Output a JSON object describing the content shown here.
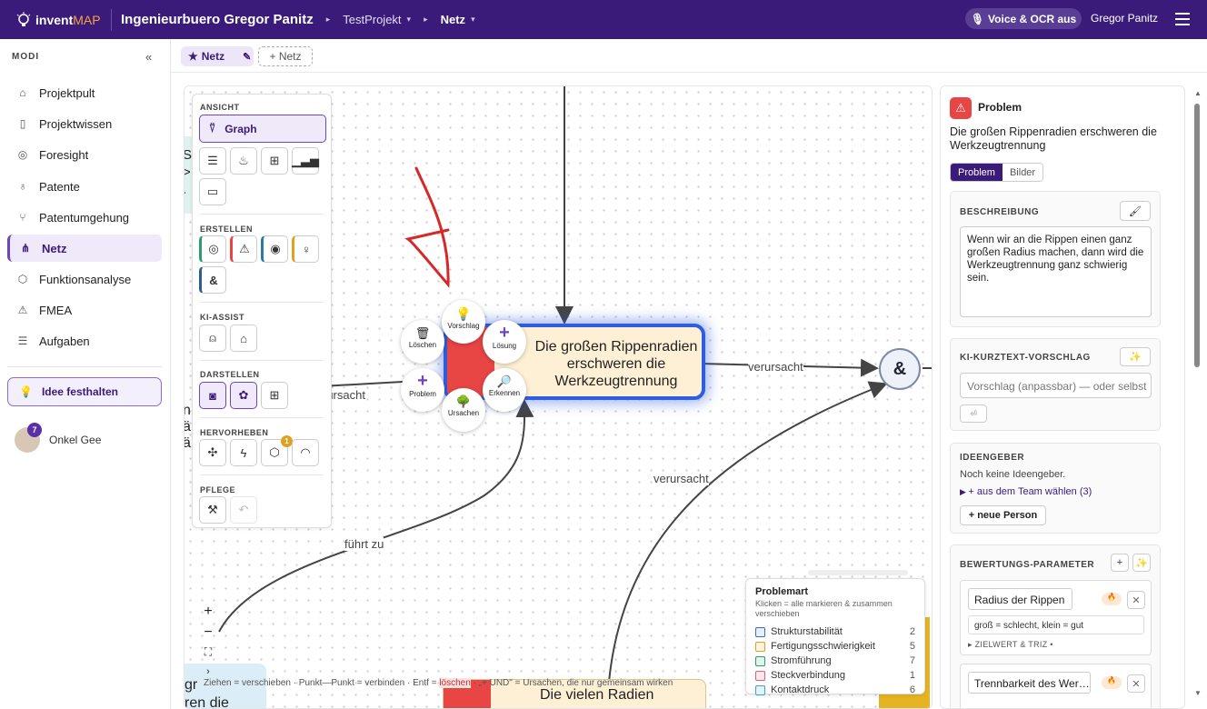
{
  "topbar": {
    "logo_main": "invent",
    "logo_accent": "MAP",
    "breadcrumb": [
      "Ingenieurbuero Gregor Panitz",
      "TestProjekt",
      "Netz"
    ],
    "voice_label": "Voice & OCR aus",
    "user_name": "Gregor Panitz"
  },
  "sidebar": {
    "heading": "MODI",
    "collapse": "«",
    "items": [
      {
        "label": "Projektpult",
        "icon": "home-icon"
      },
      {
        "label": "Projektwissen",
        "icon": "book-icon"
      },
      {
        "label": "Foresight",
        "icon": "compass-icon"
      },
      {
        "label": "Patente",
        "icon": "award-icon"
      },
      {
        "label": "Patentumgehung",
        "icon": "branch-icon"
      },
      {
        "label": "Netz",
        "icon": "network-icon",
        "active": true
      },
      {
        "label": "Funktionsanalyse",
        "icon": "cube-icon"
      },
      {
        "label": "FMEA",
        "icon": "warning-icon"
      },
      {
        "label": "Aufgaben",
        "icon": "list-icon"
      }
    ],
    "idea_button": "Idee festhalten",
    "user": {
      "name": "Onkel Gee",
      "badge": "7"
    }
  },
  "tabs": {
    "active": "Netz",
    "add": "+ Netz"
  },
  "toolbar": {
    "ansicht": "ANSICHT",
    "graph": "Graph",
    "erstellen": "ERSTELLEN",
    "ki_assist": "KI-ASSIST",
    "darstellen": "DARSTELLEN",
    "hervorheben": "HERVORHEBEN",
    "hervorheben_badge": "1",
    "pflege": "PFLEGE"
  },
  "graph": {
    "main_node": "Die großen Rippenradien erschweren die Werkzeugtrennung",
    "bottom_node": "Die vielen Radien",
    "and_node": "&",
    "edge_verursacht_1": "verursacht",
    "edge_verursacht_2": "verursacht",
    "edge_verursacht_3": "rursacht",
    "edge_fuehrt_zu": "führt zu",
    "left_clip": [
      "S",
      ">",
      "."
    ],
    "left_clip2": [
      "n",
      "ä",
      "ä"
    ],
    "bottom_left_clip": [
      "gr",
      "ren die"
    ],
    "radial_menu": [
      "Vorschlag",
      "Löschen",
      "Lösung",
      "Problem",
      "Erkennen",
      "Ursachen"
    ]
  },
  "hint": {
    "text_before": "Ziehen = verschieben · Punkt—Punkt = verbinden · Entf = ",
    "pink": "löschen",
    "text_after": " · „+ UND\" = Ursachen, die nur gemeinsam wirken"
  },
  "legend": {
    "title": "Problemart",
    "subtitle": "Klicken = alle markieren & zusammen verschieben",
    "rows": [
      {
        "label": "Strukturstabilität",
        "count": "2",
        "color": "#3b6fb6"
      },
      {
        "label": "Fertigungsschwierigkeit",
        "count": "5",
        "color": "#e0a020"
      },
      {
        "label": "Stromführung",
        "count": "7",
        "color": "#2a9d6e"
      },
      {
        "label": "Steckverbindung",
        "count": "1",
        "color": "#d9607a"
      },
      {
        "label": "Kontaktdruck",
        "count": "6",
        "color": "#3aa6c4"
      }
    ]
  },
  "detail": {
    "type": "Problem",
    "title": "Die großen Rippenradien erschweren die Werkzeugtrennung",
    "tab_problem": "Problem",
    "tab_bilder": "Bilder",
    "beschreibung_label": "BESCHREIBUNG",
    "beschreibung_text": "Wenn wir an die Rippen einen ganz großen Radius machen, dann wird die Werkzeugtrennung ganz schwierig sein.",
    "ki_label": "KI-KURZTEXT-VORSCHLAG",
    "ki_placeholder": "Vorschlag (anpassbar) — oder selbst",
    "ideengeber_label": "IDEENGEBER",
    "ideengeber_none": "Noch keine Ideengeber.",
    "ideengeber_team": "+ aus dem Team wählen (3)",
    "neue_person": "+ neue Person",
    "bewertung_label": "BEWERTUNGS-PARAMETER",
    "param1_name": "Radius der Rippen",
    "param1_scale": "groß = schlecht, klein = gut",
    "param1_zielwert": "ZIELWERT & TRIZ •",
    "param2_name": "Trennbarkeit des Wer…"
  },
  "colors": {
    "brand": "#3b1b7a",
    "accent": "#6b46c1",
    "problem_red": "#e84545",
    "node_fill": "#fdf0d5",
    "node_border": "#2f5de0"
  }
}
